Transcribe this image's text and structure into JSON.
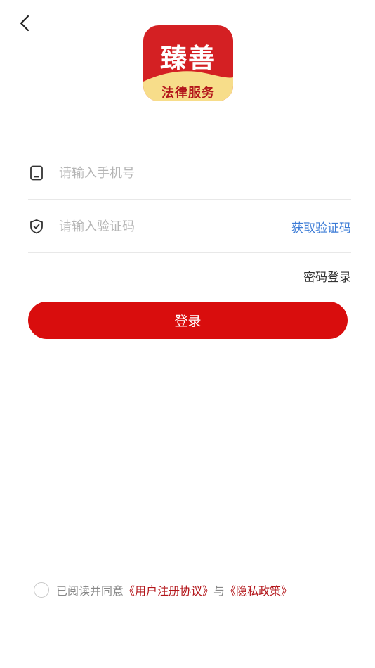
{
  "header": {
    "back_icon": "chevron-left-icon"
  },
  "logo": {
    "title": "臻善",
    "subtitle": "法律服务",
    "bg_color": "#d42023",
    "band_color": "#f7dd8a"
  },
  "form": {
    "phone": {
      "icon": "phone-icon",
      "placeholder": "请输入手机号",
      "value": ""
    },
    "code": {
      "icon": "shield-icon",
      "placeholder": "请输入验证码",
      "value": "",
      "get_code_label": "获取验证码"
    },
    "password_login_label": "密码登录",
    "login_label": "登录"
  },
  "agreement": {
    "prefix": "已阅读并同意",
    "user_agreement": "《用户注册协议》",
    "conjunction": "与",
    "privacy_policy": "《隐私政策》",
    "checked": false
  },
  "colors": {
    "primary": "#d90d0d",
    "link": "#3b7bd6",
    "agreement_link": "#b3151a"
  }
}
